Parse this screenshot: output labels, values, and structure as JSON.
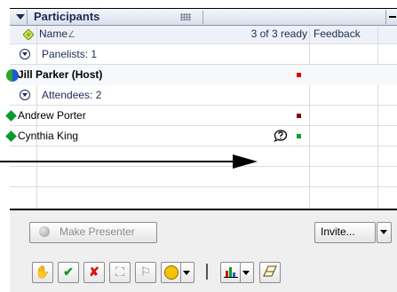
{
  "panel": {
    "title": "Participants"
  },
  "columns": {
    "name": "Name",
    "sort_indicator": "∠",
    "ready": "3 of 3 ready",
    "feedback": "Feedback"
  },
  "groups": {
    "panelists": "Panelists: 1",
    "attendees": "Attendees: 2"
  },
  "participants": [
    {
      "name": "Jill Parker (Host)",
      "status_color": "#e00000"
    },
    {
      "name": "Andrew Porter",
      "status_color": "#8b0000"
    },
    {
      "name": "Cynthia King",
      "status_color": "#0aa02a"
    }
  ],
  "buttons": {
    "make_presenter": "Make Presenter",
    "invite": "Invite..."
  },
  "colors": {
    "accent_green": "#0c9a2e",
    "header_text": "#1f2a55"
  }
}
